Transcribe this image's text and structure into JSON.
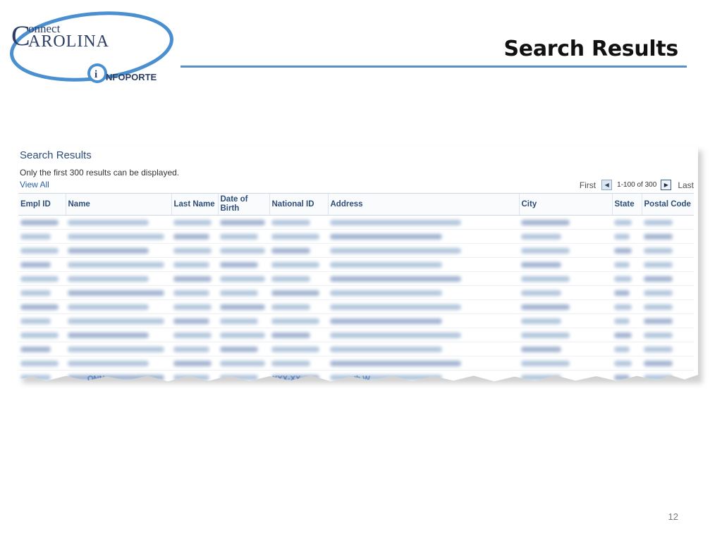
{
  "slide": {
    "title": "Search Results",
    "page_number": "12"
  },
  "logo": {
    "line1": "onnect",
    "line2": "AROLINA",
    "big_c": "C",
    "sub": "NFOPORTE",
    "colors": {
      "navy": "#2c3e66",
      "blue": "#4a8fd0"
    }
  },
  "screenshot": {
    "title": "Search Results",
    "note": "Only the first 300 results can be displayed.",
    "view_all": "View All",
    "pager": {
      "first": "First",
      "range": "1-100 of 300",
      "last": "Last"
    },
    "columns": [
      "Empl ID",
      "Name",
      "Last Name",
      "Date of Birth",
      "National ID",
      "Address",
      "City",
      "State",
      "Postal Code"
    ],
    "cut_row_fragments": [
      "ONN",
      "XXX-XX",
      "uth W"
    ],
    "colors": {
      "header_text": "#2d4e7a",
      "link": "#2b5ea8"
    }
  }
}
